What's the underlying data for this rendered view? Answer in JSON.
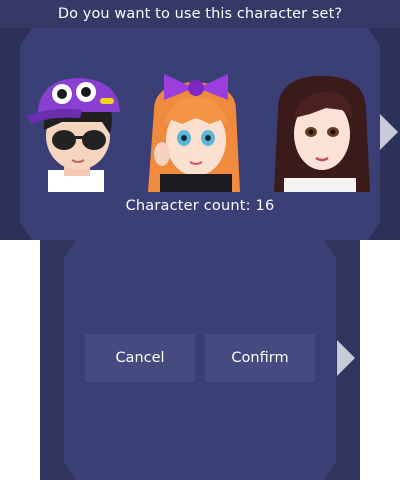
{
  "top_screen": {
    "title": "Do you want to use this character set?",
    "count_label": "Character count: 16",
    "characters": [
      {
        "name": "character-1",
        "icon": "boy-with-purple-cap-icon"
      },
      {
        "name": "character-2",
        "icon": "girl-with-purple-bow-icon"
      },
      {
        "name": "character-3",
        "icon": "girl-with-dark-hair-icon"
      }
    ],
    "next_arrow_icon": "right-arrow-icon"
  },
  "bottom_screen": {
    "cancel_label": "Cancel",
    "confirm_label": "Confirm",
    "next_arrow_icon": "right-arrow-icon"
  },
  "colors": {
    "panel_bg": "#3a3f75",
    "side_panel": "#2b3158",
    "button_bg": "#454a80",
    "arrow": "#c8cad8",
    "text": "#ffffff"
  }
}
